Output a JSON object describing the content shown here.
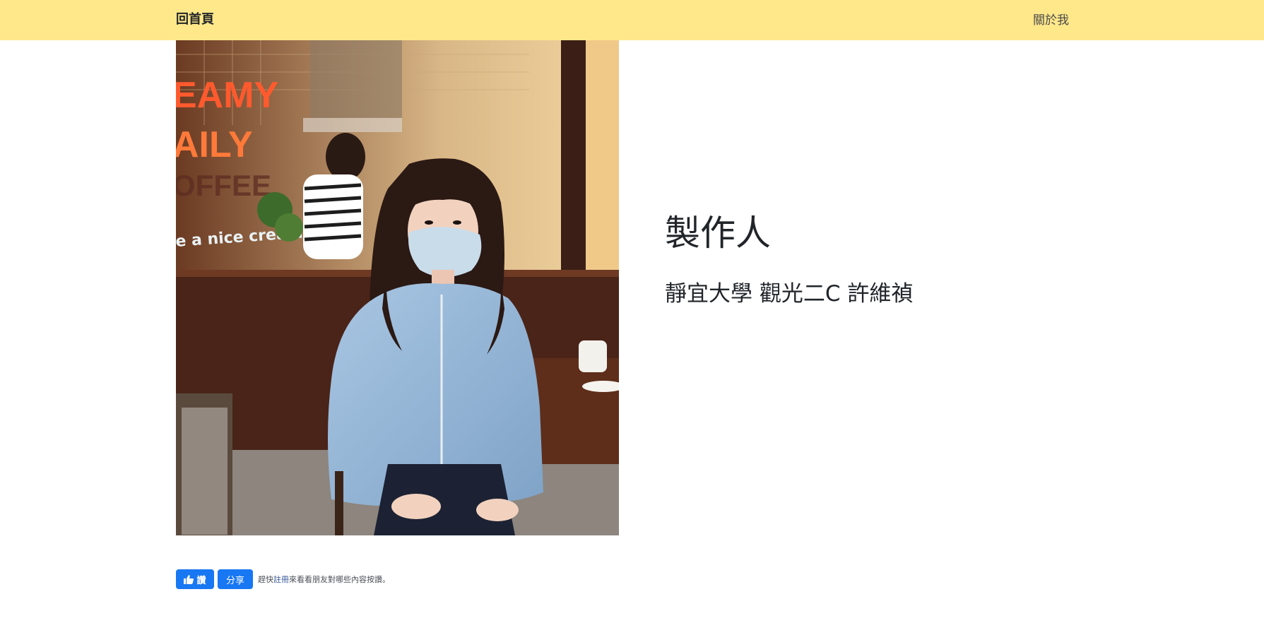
{
  "navbar": {
    "home_label": "回首頁",
    "about_label": "關於我",
    "background_color": "#ffe88a"
  },
  "profile": {
    "photo_text": {
      "sign_line1": "EAMY",
      "sign_line2": "AILY",
      "sign_line3": "OFFEE",
      "window_text": "e a nice creamy daily"
    },
    "heading": "製作人",
    "subtext": "靜宜大學 觀光二C 許維禎"
  },
  "facebook": {
    "like_label": "讚",
    "share_label": "分享",
    "note_prefix": "趕快",
    "note_link": "註冊",
    "note_suffix": "來看看朋友對哪些內容按讚。",
    "button_color": "#1877f2"
  }
}
